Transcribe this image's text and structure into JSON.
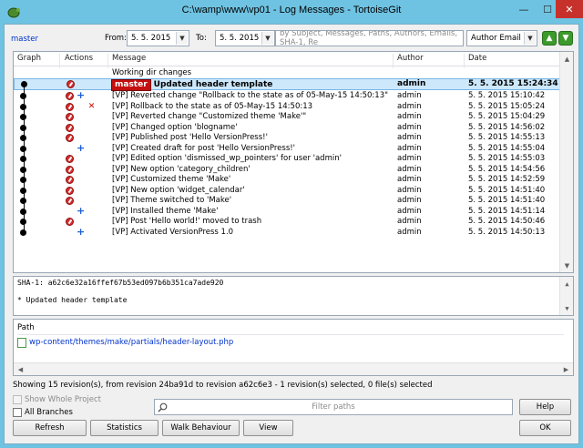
{
  "window": {
    "title": "C:\\wamp\\www\\vp01 - Log Messages - TortoiseGit",
    "minimize_glyph": "—",
    "maximize_glyph": "☐",
    "close_glyph": "✕"
  },
  "toolbar": {
    "branch_link": "master",
    "from_label": "From:",
    "from_date": "5.   5. 2015",
    "to_label": "To:",
    "to_date": "5.   5. 2015",
    "search_placeholder": "by Subject, Messages, Paths, Authors, Emails, SHA-1, Re",
    "filter_field": "Author Email",
    "dropdown_glyph": "▼",
    "up_arrow_glyph": "▲",
    "down_arrow_glyph": "▼"
  },
  "log": {
    "columns": [
      "Graph",
      "Actions",
      "Message",
      "Author",
      "Date"
    ],
    "working_dir": "Working dir changes",
    "selected": {
      "ref": "master",
      "message": "Updated header template",
      "author": "admin",
      "date": "5. 5. 2015 15:24:34"
    },
    "rows": [
      {
        "message": "[VP] Reverted change \"Rollback to the state as of 05-May-15 14:50:13\"",
        "author": "admin",
        "date": "5. 5. 2015 15:10:42",
        "actions": [
          "modify",
          "add"
        ]
      },
      {
        "message": "[VP] Rollback to the state as of 05-May-15 14:50:13",
        "author": "admin",
        "date": "5. 5. 2015 15:05:24",
        "actions": [
          "modify",
          "delete"
        ]
      },
      {
        "message": "[VP] Reverted change \"Customized theme 'Make'\"",
        "author": "admin",
        "date": "5. 5. 2015 15:04:29",
        "actions": [
          "modify"
        ]
      },
      {
        "message": "[VP] Changed option 'blogname'",
        "author": "admin",
        "date": "5. 5. 2015 14:56:02",
        "actions": [
          "modify"
        ]
      },
      {
        "message": "[VP] Published post 'Hello VersionPress!'",
        "author": "admin",
        "date": "5. 5. 2015 14:55:13",
        "actions": [
          "modify"
        ]
      },
      {
        "message": "[VP] Created draft for post 'Hello VersionPress!'",
        "author": "admin",
        "date": "5. 5. 2015 14:55:04",
        "actions": [
          "add"
        ]
      },
      {
        "message": "[VP] Edited option 'dismissed_wp_pointers' for user 'admin'",
        "author": "admin",
        "date": "5. 5. 2015 14:55:03",
        "actions": [
          "modify"
        ]
      },
      {
        "message": "[VP] New option 'category_children'",
        "author": "admin",
        "date": "5. 5. 2015 14:54:56",
        "actions": [
          "modify"
        ]
      },
      {
        "message": "[VP] Customized theme 'Make'",
        "author": "admin",
        "date": "5. 5. 2015 14:52:59",
        "actions": [
          "modify"
        ]
      },
      {
        "message": "[VP] New option 'widget_calendar'",
        "author": "admin",
        "date": "5. 5. 2015 14:51:40",
        "actions": [
          "modify"
        ]
      },
      {
        "message": "[VP] Theme switched to 'Make'",
        "author": "admin",
        "date": "5. 5. 2015 14:51:40",
        "actions": [
          "modify"
        ]
      },
      {
        "message": "[VP] Installed theme 'Make'",
        "author": "admin",
        "date": "5. 5. 2015 14:51:14",
        "actions": [
          "add"
        ]
      },
      {
        "message": "[VP] Post 'Hello world!' moved to trash",
        "author": "admin",
        "date": "5. 5. 2015 14:50:46",
        "actions": [
          "modify"
        ]
      },
      {
        "message": "[VP] Activated VersionPress 1.0",
        "author": "admin",
        "date": "5. 5. 2015 14:50:13",
        "actions": [
          "add"
        ]
      }
    ]
  },
  "details": {
    "sha": "SHA-1: a62c6e32a16ffef67b53ed097b6b351ca7ade920",
    "message": "* Updated header template"
  },
  "paths": {
    "header": "Path",
    "file": "wp-content/themes/make/partials/header-layout.php"
  },
  "status": "Showing 15 revision(s), from revision 24ba91d to revision a62c6e3 - 1 revision(s) selected, 0 file(s) selected",
  "options": {
    "show_whole_project": "Show Whole Project",
    "all_branches": "All Branches",
    "filter_placeholder": "Filter paths"
  },
  "buttons": {
    "help": "Help",
    "refresh": "Refresh",
    "statistics": "Statistics",
    "walk": "Walk Behaviour",
    "view": "View",
    "ok": "OK"
  },
  "colors": {
    "accent": "#6fc3e2",
    "selection": "#cde8fb",
    "ref_badge": "#c40f0f",
    "close": "#c7312b"
  }
}
